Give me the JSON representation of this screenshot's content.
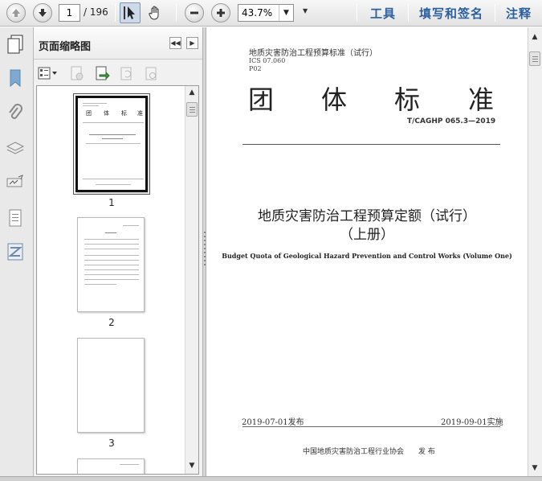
{
  "toolbar": {
    "current_page": "1",
    "total_pages": "/ 196",
    "zoom": "43.7%",
    "links": [
      "工具",
      "填写和签名",
      "注释"
    ]
  },
  "icons": {
    "prev": "arrow-up-icon",
    "next": "arrow-down-icon",
    "select": "select-cursor-icon",
    "hand": "hand-icon",
    "zoom_out": "minus-icon",
    "zoom_in": "plus-icon"
  },
  "panel": {
    "title": "页面缩略图",
    "thumb_labels": [
      "1",
      "2",
      "3"
    ]
  },
  "doc": {
    "header": "地质灾害防治工程预算标准（试行）",
    "ics": "ICS 07.060",
    "code": "P02",
    "big_chars": [
      "团",
      "体",
      "标",
      "准"
    ],
    "standard_no": "T/CAGHP 065.3—2019",
    "title_line1": "地质灾害防治工程预算定额（试行）",
    "title_line2": "（上册）",
    "title_en": "Budget Quota of Geological Hazard Prevention and Control Works (Volume One)",
    "publish_date": "2019-07-01发布",
    "effective_date": "2019-09-01实施",
    "org": "中国地质灾害防治工程行业协会　　发 布"
  },
  "colors": {
    "accent_link": "#2b5f9e",
    "panel_bg": "#f1f1f1"
  }
}
